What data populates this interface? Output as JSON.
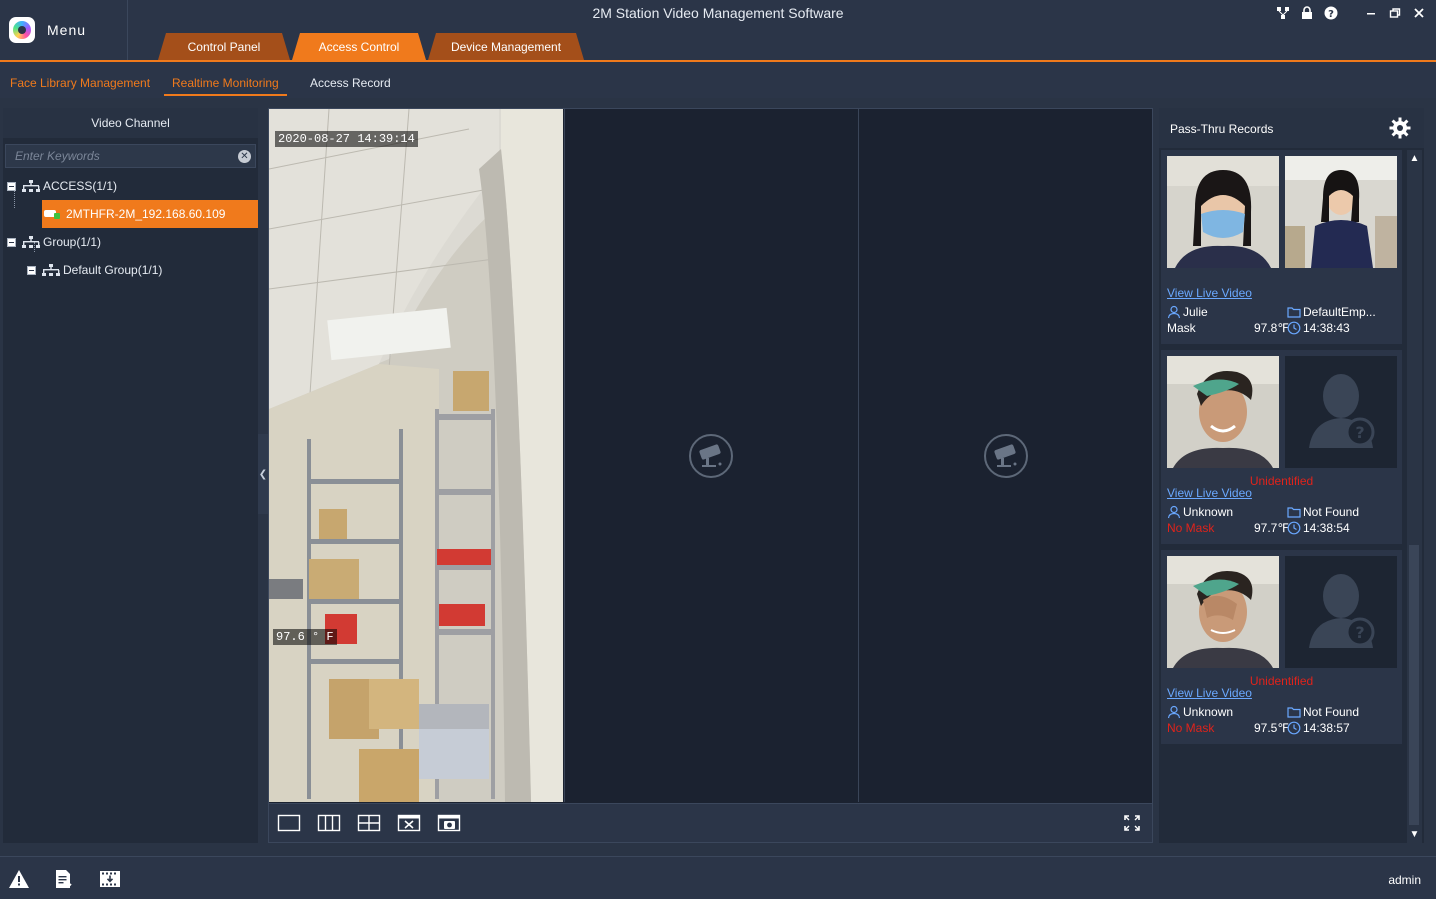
{
  "app": {
    "menu_label": "Menu",
    "title": "2M Station Video Management Software"
  },
  "tabs": [
    {
      "label": "Control Panel"
    },
    {
      "label": "Access Control",
      "active": true
    },
    {
      "label": "Device Management"
    }
  ],
  "subtabs": [
    {
      "label": "Face Library Management"
    },
    {
      "label": "Realtime Monitoring",
      "active": true
    },
    {
      "label": "Access Record"
    }
  ],
  "left_panel": {
    "title": "Video Channel",
    "search_placeholder": "Enter Keywords",
    "tree": [
      {
        "label": "ACCESS(1/1)"
      },
      {
        "label": "2MTHFR-2M_192.168.60.109",
        "selected": true
      },
      {
        "label": "Group(1/1)"
      },
      {
        "label": "Default Group(1/1)"
      }
    ]
  },
  "video": {
    "timestamp": "2020-08-27 14:39:14",
    "temperature_overlay": "97.6 ° F"
  },
  "right_panel": {
    "title": "Pass-Thru Records",
    "records": [
      {
        "status": "",
        "link": "View Live Video",
        "name": "Julie",
        "group": "DefaultEmp...",
        "mask": "Mask",
        "temp": "97.8℉",
        "time": "14:38:43"
      },
      {
        "status": "Unidentified",
        "link": "View Live Video",
        "name": "Unknown",
        "group": "Not Found",
        "mask": "No Mask",
        "temp": "97.7℉",
        "time": "14:38:54"
      },
      {
        "status": "Unidentified",
        "link": "View Live Video",
        "name": "Unknown",
        "group": "Not Found",
        "mask": "No Mask",
        "temp": "97.5℉",
        "time": "14:38:57"
      }
    ]
  },
  "statusbar": {
    "user": "admin"
  },
  "colors": {
    "accent": "#f07a1c",
    "alert": "#e0231b",
    "link": "#6aa8ff",
    "bg": "#2a3445"
  }
}
